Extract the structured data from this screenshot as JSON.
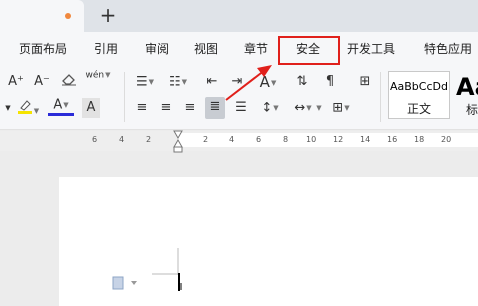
{
  "tabs": {
    "add_symbol": "+"
  },
  "menu": [
    {
      "label": "页面布局"
    },
    {
      "label": "引用"
    },
    {
      "label": "审阅"
    },
    {
      "label": "视图"
    },
    {
      "label": "章节"
    },
    {
      "label": "安全"
    },
    {
      "label": "开发工具"
    },
    {
      "label": "特色应用"
    }
  ],
  "toolbar": {
    "font_grow": "A⁺",
    "font_shrink": "A⁻",
    "phonetic": "wén",
    "font_color": "A",
    "char_shade": "A"
  },
  "styles": {
    "normal_sample": "AaBbCcDd",
    "normal_name": "正文",
    "heading_sample": "Aa",
    "heading_name": "标"
  },
  "ruler_ticks": [
    "6",
    "4",
    "2",
    "2",
    "4",
    "6",
    "8",
    "10",
    "12",
    "14",
    "16",
    "18",
    "20"
  ],
  "colors": {
    "accent_red": "#e0201b",
    "tab_dot": "#f0883e"
  }
}
